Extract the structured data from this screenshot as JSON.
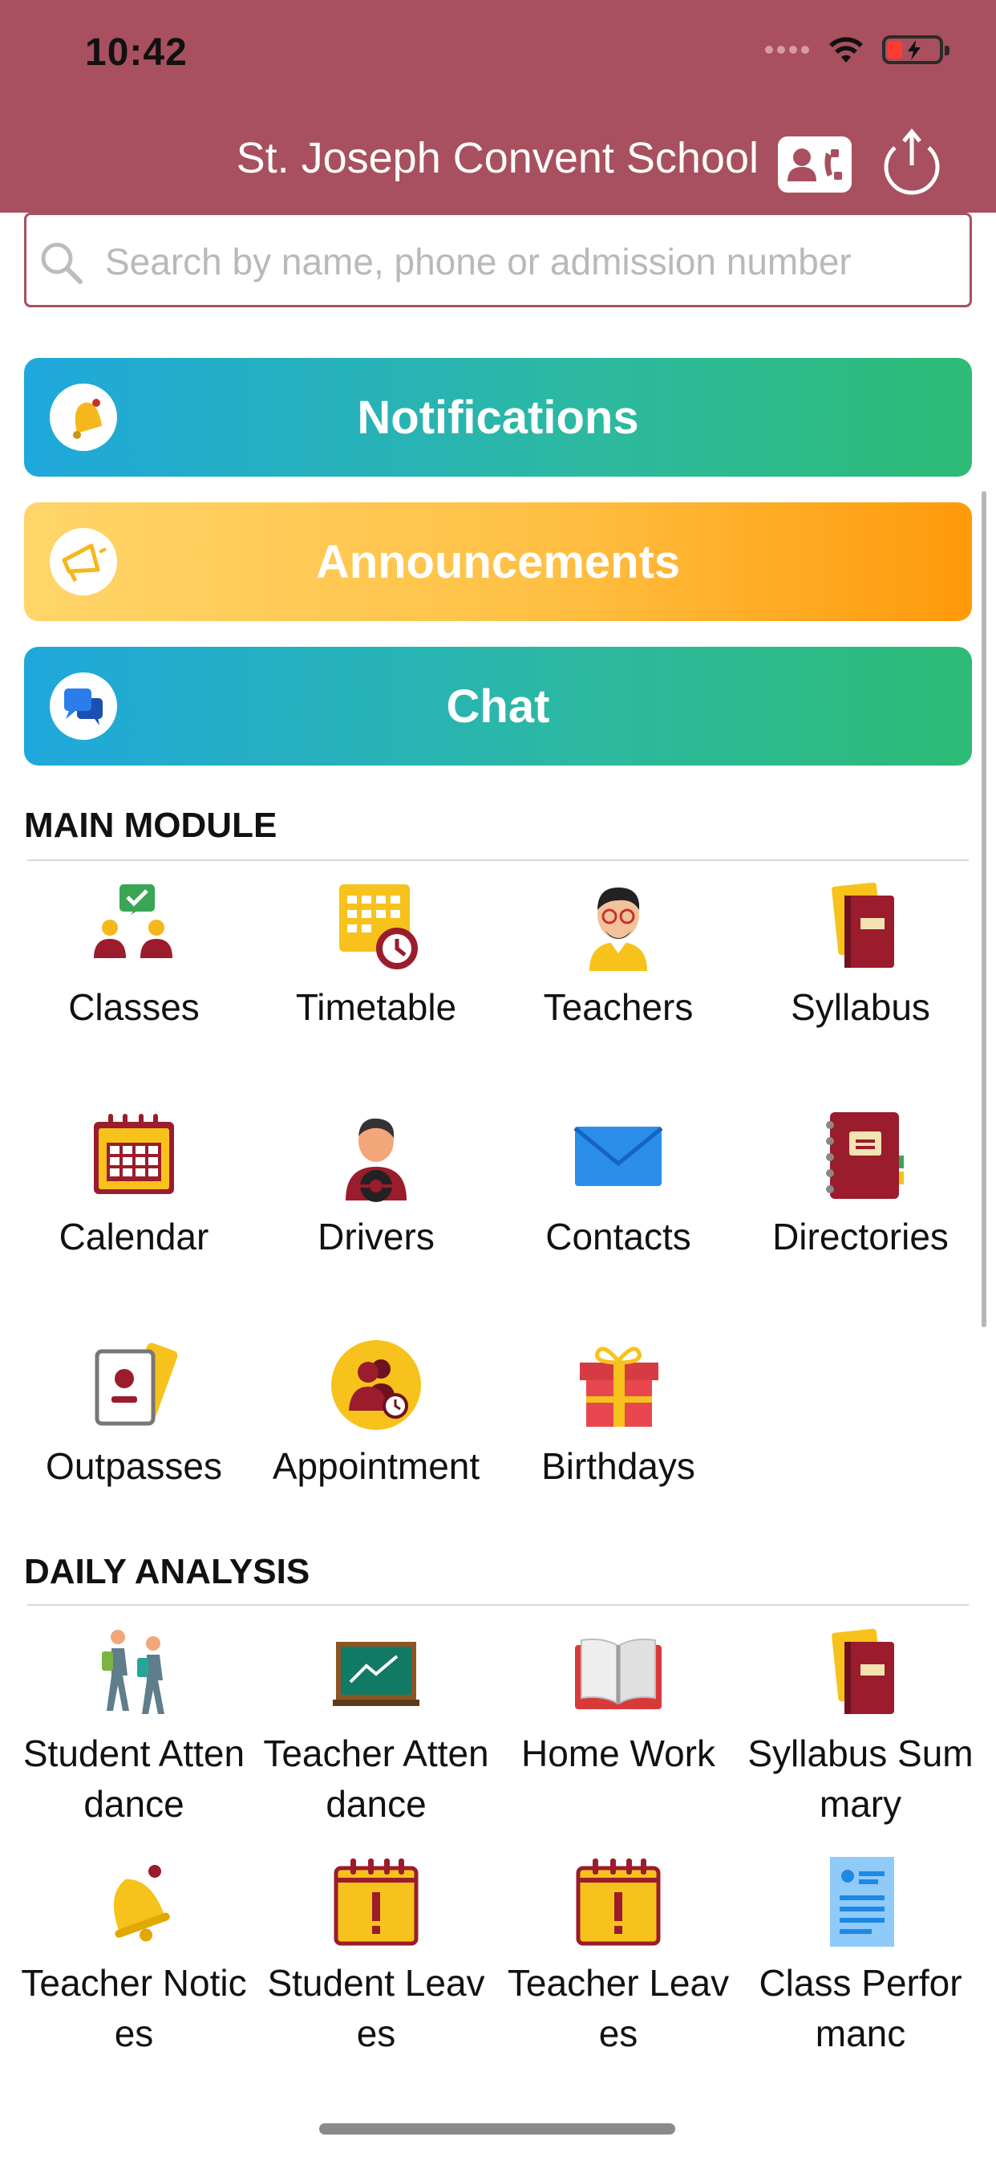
{
  "status_bar": {
    "time": "10:42"
  },
  "header": {
    "school_name": "St. Joseph Convent School"
  },
  "search": {
    "placeholder": "Search by name, phone or admission number",
    "value": ""
  },
  "actions": [
    {
      "label": "Notifications"
    },
    {
      "label": "Announcements"
    },
    {
      "label": "Chat"
    }
  ],
  "main_module": {
    "title": "MAIN MODULE",
    "items": [
      {
        "label": "Classes",
        "icon": "classes-icon"
      },
      {
        "label": "Timetable",
        "icon": "timetable-icon"
      },
      {
        "label": "Teachers",
        "icon": "teacher-avatar-icon"
      },
      {
        "label": "Syllabus",
        "icon": "books-icon"
      },
      {
        "label": "Calendar",
        "icon": "calendar-icon"
      },
      {
        "label": "Drivers",
        "icon": "driver-icon"
      },
      {
        "label": "Contacts",
        "icon": "mail-icon"
      },
      {
        "label": "Directories",
        "icon": "directory-book-icon"
      },
      {
        "label": "Outpasses",
        "icon": "outpass-card-icon"
      },
      {
        "label": "Appointment",
        "icon": "appointment-icon"
      },
      {
        "label": "Birthdays",
        "icon": "gift-icon"
      }
    ]
  },
  "daily_analysis": {
    "title": "DAILY ANALYSIS",
    "items": [
      {
        "label": "Student Attendance",
        "icon": "students-walking-icon"
      },
      {
        "label": "Teacher Attendance",
        "icon": "chalkboard-icon"
      },
      {
        "label": "Home Work",
        "icon": "open-book-icon"
      },
      {
        "label": "Syllabus Summary",
        "icon": "books-icon"
      },
      {
        "label": "Teacher Notices",
        "icon": "bell-icon"
      },
      {
        "label": "Student Leaves",
        "icon": "calendar-alert-icon"
      },
      {
        "label": "Teacher Leaves",
        "icon": "calendar-alert-icon"
      },
      {
        "label": "Class Performanc",
        "icon": "report-icon"
      }
    ]
  },
  "colors": {
    "header": "#a8505f",
    "teal_gradient_start": "#1fa8dc",
    "teal_gradient_end": "#2dbb75",
    "orange_gradient_start": "#ffd56a",
    "orange_gradient_end": "#ff9a0a",
    "icon_red": "#9b1c2c",
    "icon_yellow": "#f7c21b"
  }
}
